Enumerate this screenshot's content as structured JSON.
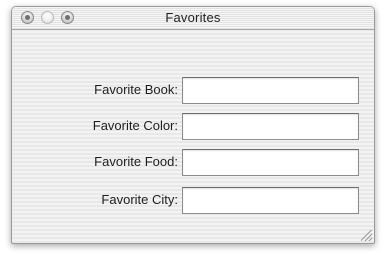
{
  "window": {
    "title": "Favorites"
  },
  "title_buttons": [
    {
      "name": "close-button",
      "icon": "close-icon"
    },
    {
      "name": "minimize-button",
      "icon": "minimize-icon"
    },
    {
      "name": "zoom-button",
      "icon": "zoom-icon"
    }
  ],
  "form": {
    "fields": [
      {
        "label": "Favorite Book:",
        "value": "",
        "placeholder": ""
      },
      {
        "label": "Favorite Color:",
        "value": "",
        "placeholder": ""
      },
      {
        "label": "Favorite Food:",
        "value": "",
        "placeholder": ""
      },
      {
        "label": "Favorite City:",
        "value": "",
        "placeholder": ""
      }
    ]
  },
  "colors": {
    "window_border": "#9a9a9a",
    "pinstripe_light": "#f3f3f3",
    "pinstripe_dark": "#e8e8e8",
    "field_background": "#ffffff"
  }
}
